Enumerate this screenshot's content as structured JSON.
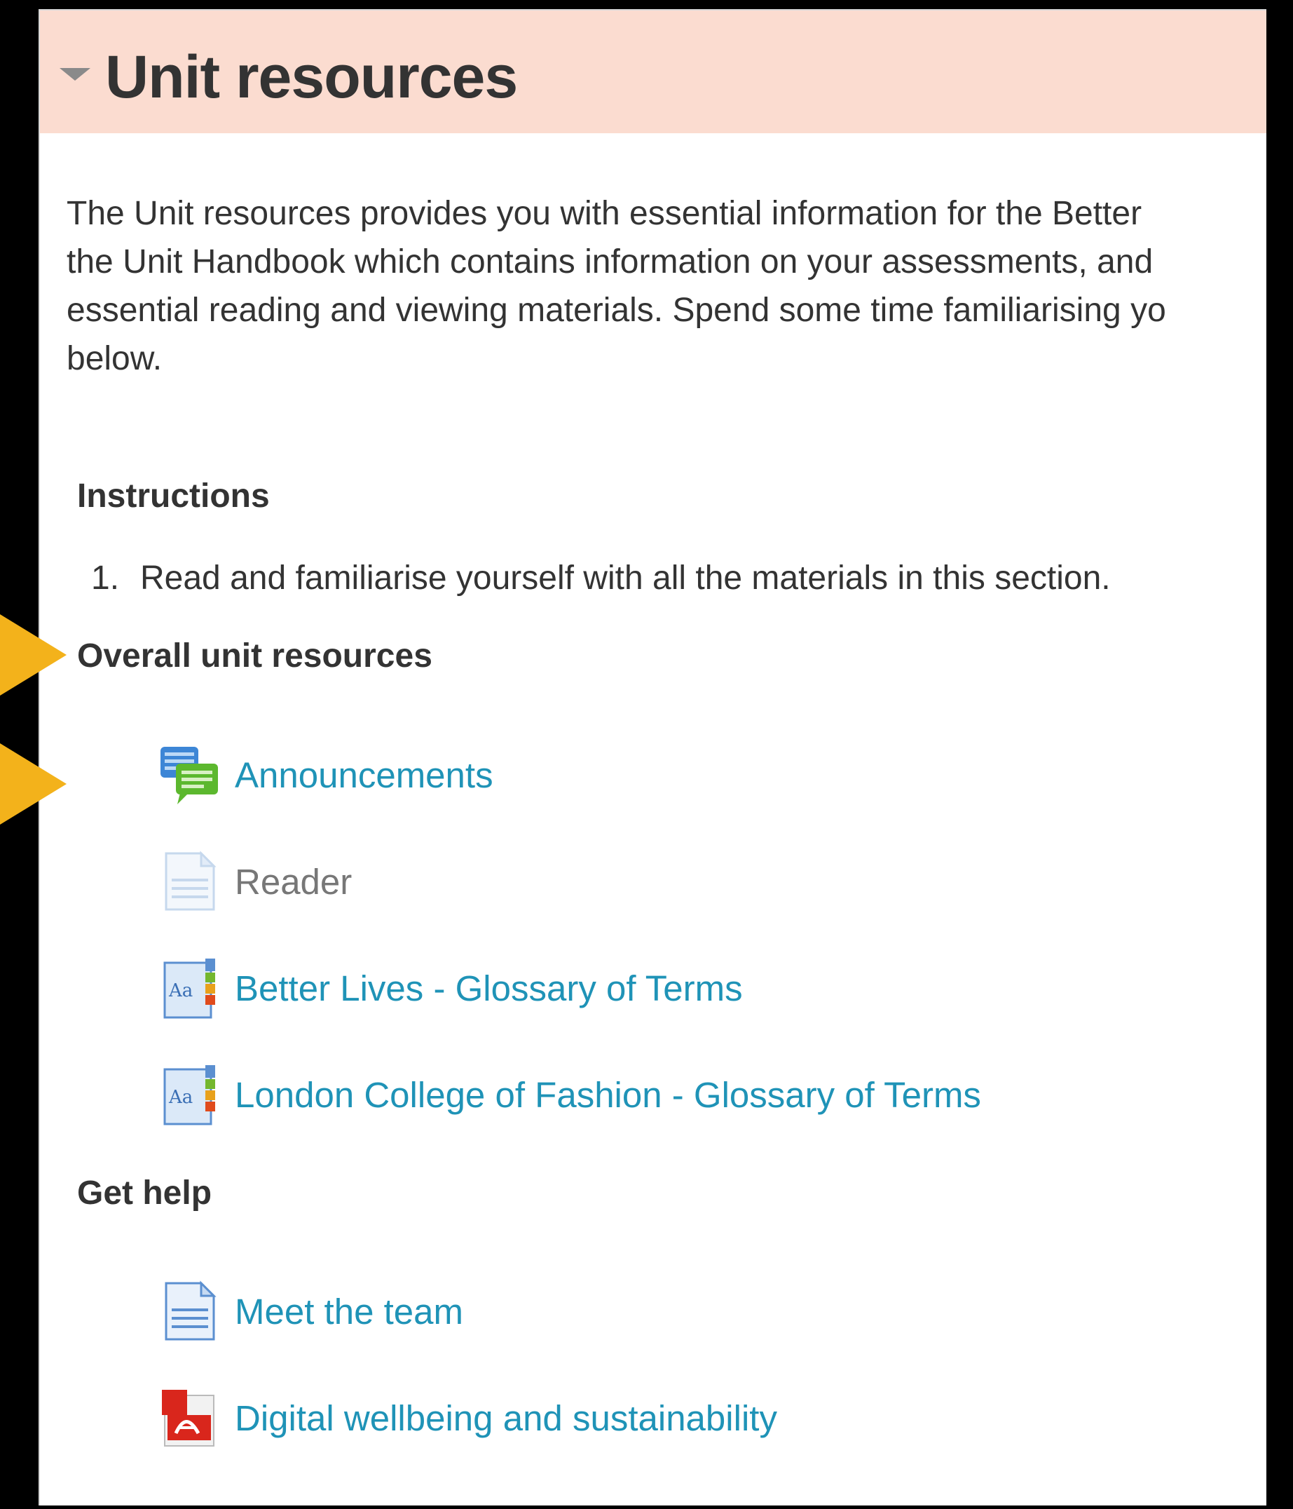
{
  "section": {
    "title": "Unit resources",
    "summary_lines": [
      "The Unit resources provides you with essential information for the Better",
      "the Unit Handbook which contains information on your assessments, and",
      "essential reading and viewing materials. Spend some time familiarising yo",
      "below."
    ]
  },
  "instructions": {
    "heading": "Instructions",
    "items": [
      {
        "number": "1.",
        "text": "Read and familiarise yourself with all the materials in this section."
      }
    ]
  },
  "overall_resources": {
    "heading": "Overall unit resources",
    "activities": [
      {
        "label": "Announcements",
        "icon": "forum-icon",
        "dimmed": false
      },
      {
        "label": "Reader",
        "icon": "page-icon",
        "dimmed": true
      },
      {
        "label": "Better Lives - Glossary of Terms",
        "icon": "glossary-icon",
        "dimmed": false
      },
      {
        "label": "London College of Fashion - Glossary of Terms",
        "icon": "glossary-icon",
        "dimmed": false
      }
    ]
  },
  "get_help": {
    "heading": "Get help",
    "activities": [
      {
        "label": "Meet the team",
        "icon": "page-icon",
        "dimmed": false
      },
      {
        "label": "Digital wellbeing and sustainability",
        "icon": "pdf-icon",
        "dimmed": false
      }
    ]
  },
  "colors": {
    "header_bg": "#fbdcd0",
    "link": "#1f93b7",
    "annotation_arrow": "#f3b21b"
  }
}
